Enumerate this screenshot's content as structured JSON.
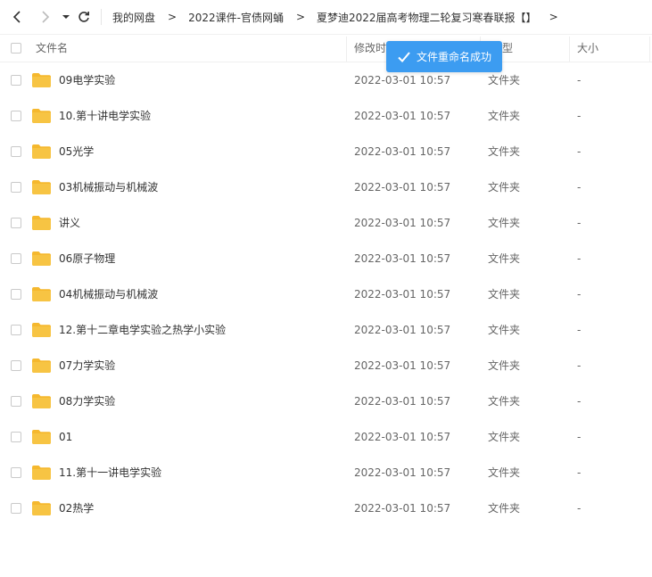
{
  "nav": {
    "back_icon": "chevron-left-icon",
    "forward_icon": "chevron-right-icon",
    "dropdown_icon": "caret-down-icon",
    "refresh_icon": "refresh-icon"
  },
  "breadcrumb": [
    "我的网盘",
    "2022课件-官债网蛹",
    "夏梦迪2022届高考物理二轮复习寒春联报【】"
  ],
  "breadcrumb_separator": ">",
  "columns": {
    "name": "文件名",
    "modified": "修改时",
    "type": "型",
    "size": "大小"
  },
  "toast": {
    "text": "文件重命名成功",
    "icon": "check-icon",
    "color": "#3c9cf1"
  },
  "files": [
    {
      "name": "09电学实验",
      "modified": "2022-03-01 10:57",
      "type": "文件夹",
      "size": "-"
    },
    {
      "name": "10.第十讲电学实验",
      "modified": "2022-03-01 10:57",
      "type": "文件夹",
      "size": "-"
    },
    {
      "name": "05光学",
      "modified": "2022-03-01 10:57",
      "type": "文件夹",
      "size": "-"
    },
    {
      "name": "03机械振动与机械波",
      "modified": "2022-03-01 10:57",
      "type": "文件夹",
      "size": "-"
    },
    {
      "name": "讲义",
      "modified": "2022-03-01 10:57",
      "type": "文件夹",
      "size": "-"
    },
    {
      "name": "06原子物理",
      "modified": "2022-03-01 10:57",
      "type": "文件夹",
      "size": "-"
    },
    {
      "name": "04机械振动与机械波",
      "modified": "2022-03-01 10:57",
      "type": "文件夹",
      "size": "-"
    },
    {
      "name": "12.第十二章电学实验之热学小实验",
      "modified": "2022-03-01 10:57",
      "type": "文件夹",
      "size": "-"
    },
    {
      "name": "07力学实验",
      "modified": "2022-03-01 10:57",
      "type": "文件夹",
      "size": "-"
    },
    {
      "name": "08力学实验",
      "modified": "2022-03-01 10:57",
      "type": "文件夹",
      "size": "-"
    },
    {
      "name": "01",
      "modified": "2022-03-01 10:57",
      "type": "文件夹",
      "size": "-"
    },
    {
      "name": "11.第十一讲电学实验",
      "modified": "2022-03-01 10:57",
      "type": "文件夹",
      "size": "-"
    },
    {
      "name": "02热学",
      "modified": "2022-03-01 10:57",
      "type": "文件夹",
      "size": "-"
    }
  ],
  "colors": {
    "folder": "#f7c443",
    "folder_tab": "#f5b82e",
    "accent": "#3c9cf1"
  }
}
